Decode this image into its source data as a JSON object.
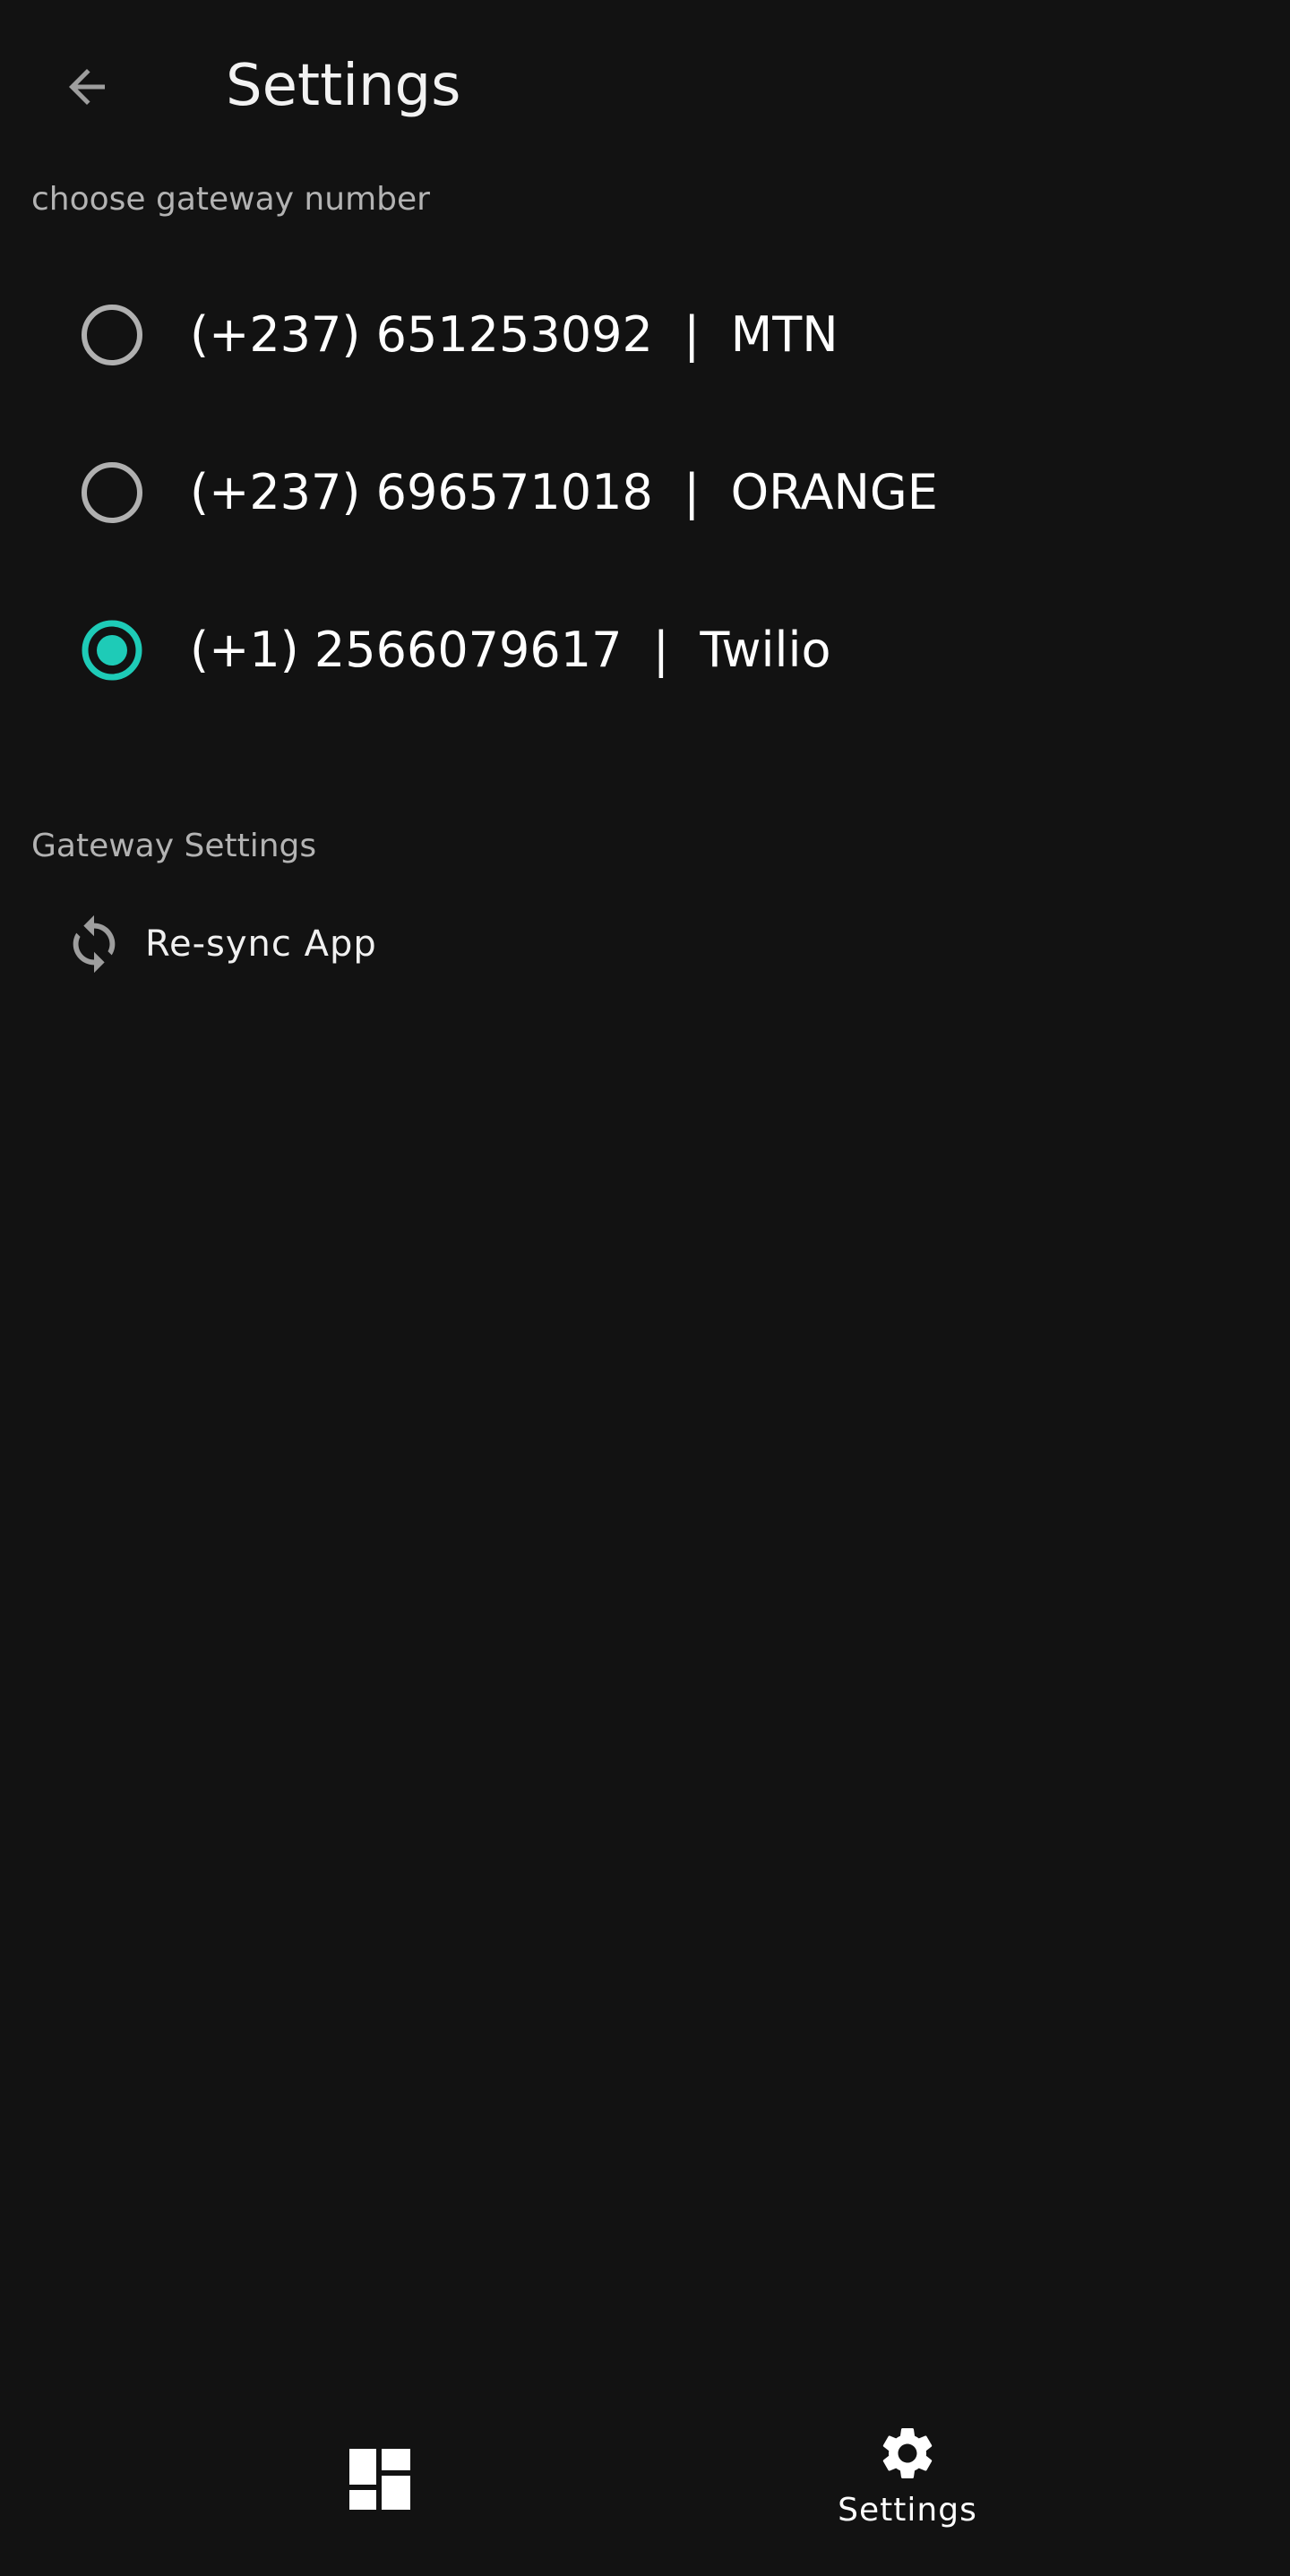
{
  "app_bar": {
    "title": "Settings",
    "back_icon": "arrow-left-icon"
  },
  "gateway_section": {
    "header": "choose gateway number",
    "options": [
      {
        "label": "(+237) 651253092  |  MTN",
        "selected": false
      },
      {
        "label": "(+237) 696571018  |  ORANGE",
        "selected": false
      },
      {
        "label": "(+1) 2566079617  |  Twilio",
        "selected": true
      }
    ]
  },
  "gateway_settings": {
    "header": "Gateway Settings",
    "items": [
      {
        "label": "Re-sync App",
        "icon": "sync-icon"
      }
    ]
  },
  "bottom_nav": {
    "items": [
      {
        "label": "",
        "icon": "dashboard-icon",
        "active": false
      },
      {
        "label": "Settings",
        "icon": "gear-icon",
        "active": true
      }
    ]
  },
  "colors": {
    "background": "#121212",
    "accent": "#1ecbb7",
    "radio_off": "#b0b0b0",
    "muted_text": "#b3b3b3"
  }
}
